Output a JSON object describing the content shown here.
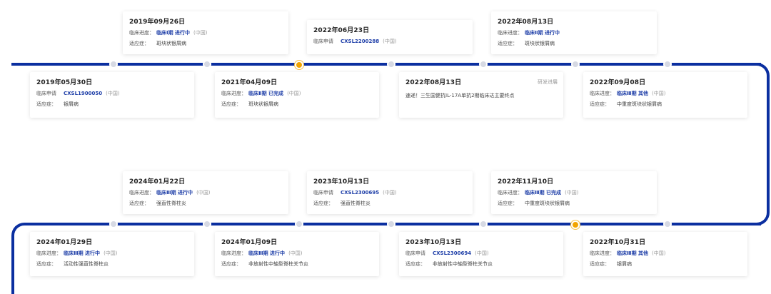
{
  "colors": {
    "line": "#0b2fa0",
    "link": "#1f3fa8",
    "active_dot": "#f2a400"
  },
  "events": [
    {
      "date": "2019年09月26日",
      "r1k": "临床进度：",
      "r1v": "临床Ⅰ期 进行中",
      "r1r": "(中国)",
      "r2k": "适应症：",
      "r2v": "斑块状银屑病"
    },
    {
      "date": "2022年06月23日",
      "r1k": "临床申请",
      "r1v": "CXSL2200288",
      "r1r": "(中国)"
    },
    {
      "date": "2022年08月13日",
      "r1k": "临床进度：",
      "r1v": "临床Ⅱ期 进行中",
      "r1r": "",
      "r2k": "适应症：",
      "r2v": "斑块状银屑病"
    },
    {
      "date": "2019年05月30日",
      "r1k": "临床申请",
      "r1v": "CXSL1900050",
      "r1r": "(中国)",
      "r2k": "适应症：",
      "r2v": "银屑病"
    },
    {
      "date": "2021年04月09日",
      "r1k": "临床进度：",
      "r1v": "临床Ⅱ期 已完成",
      "r1r": "(中国)",
      "r2k": "适应症：",
      "r2v": "斑块状银屑病"
    },
    {
      "date": "2022年08月13日",
      "tag": "研发进展",
      "text": "速递！三生国健抗IL-17A单抗2期临床达主要终点"
    },
    {
      "date": "2022年09月08日",
      "r1k": "临床进度：",
      "r1v": "临床Ⅲ期 其他",
      "r1r": "(中国)",
      "r2k": "适应症：",
      "r2v": "中重度斑块状银屑病"
    },
    {
      "date": "2024年01月22日",
      "r1k": "临床进度：",
      "r1v": "临床Ⅲ期 进行中",
      "r1r": "(中国)",
      "r2k": "适应症：",
      "r2v": "强直性脊柱炎"
    },
    {
      "date": "2023年10月13日",
      "r1k": "临床申请",
      "r1v": "CXSL2300695",
      "r1r": "(中国)",
      "r2k": "适应症：",
      "r2v": "强直性脊柱炎"
    },
    {
      "date": "2022年11月10日",
      "r1k": "临床进度：",
      "r1v": "临床Ⅲ期 已完成",
      "r1r": "(中国)",
      "r2k": "适应症：",
      "r2v": "中重度斑块状银屑病"
    },
    {
      "date": "2024年01月29日",
      "r1k": "临床进度：",
      "r1v": "临床Ⅲ期 进行中",
      "r1r": "(中国)",
      "r2k": "适应症：",
      "r2v": "活动性强直性脊柱炎"
    },
    {
      "date": "2024年01月09日",
      "r1k": "临床进度：",
      "r1v": "临床Ⅲ期 进行中",
      "r1r": "(中国)",
      "r2k": "适应症：",
      "r2v": "非放射性中轴型脊柱关节炎"
    },
    {
      "date": "2023年10月13日",
      "r1k": "临床申请",
      "r1v": "CXSL2300694",
      "r1r": "(中国)",
      "r2k": "适应症：",
      "r2v": "非放射性中轴型脊柱关节炎"
    },
    {
      "date": "2022年10月31日",
      "r1k": "临床进度：",
      "r1v": "临床Ⅲ期 其他",
      "r1r": "(中国)",
      "r2k": "适应症：",
      "r2v": "银屑病"
    }
  ]
}
